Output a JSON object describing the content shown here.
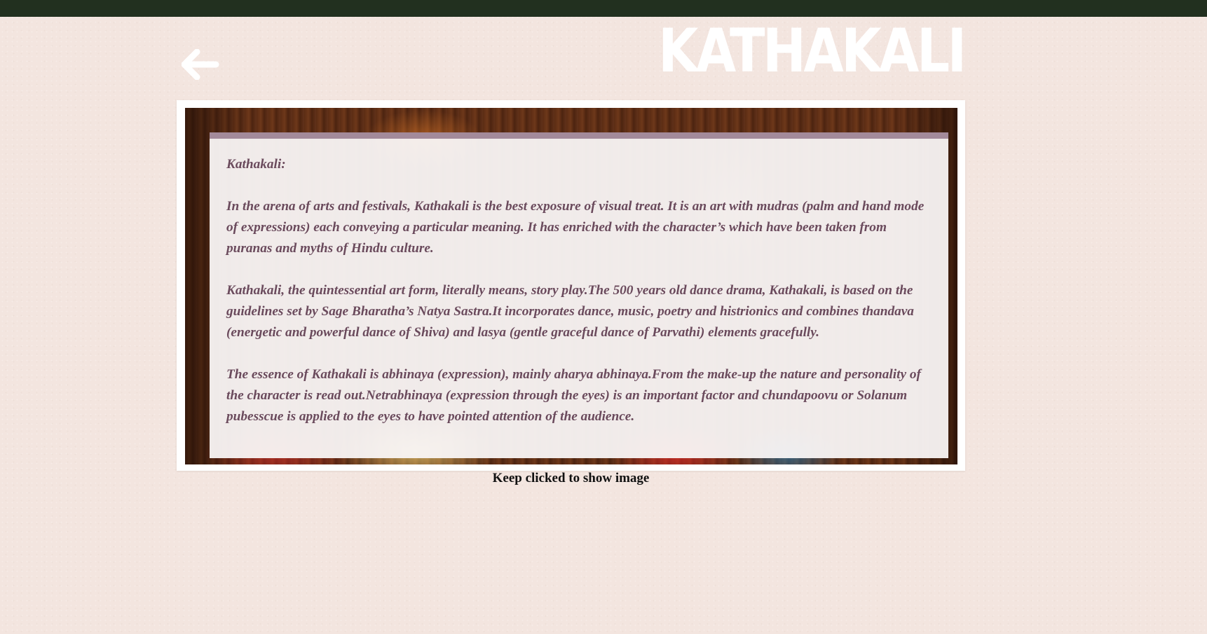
{
  "header": {
    "title": "KATHAKALI",
    "back_icon": "arrow-left-icon"
  },
  "colors": {
    "topbar": "#22301f",
    "background": "#f3e5df",
    "title": "#ffffff",
    "panel_border": "#a38a9a",
    "body_text": "#6a4a5c"
  },
  "content": {
    "heading": "Kathakali:",
    "paragraphs": [
      "In the arena of arts and festivals, Kathakali is the best exposure of visual treat. It is an art with mudras (palm and hand mode of expressions) each conveying a particular meaning. It has enriched with the character’s which have been taken from puranas and myths of Hindu culture.",
      "Kathakali, the quintessential art form, literally means, story play.The 500 years old dance drama, Kathakali, is based on the guidelines set by Sage Bharatha’s Natya Sastra.It incorporates dance, music, poetry and histrionics and combines thandava (energetic and powerful dance of Shiva) and lasya (gentle graceful dance of Parvathi) elements gracefully.",
      "The essence of Kathakali is abhinaya (expression), mainly aharya abhinaya.From the make-up the nature and personality of the character is read out.Netrabhinaya (expression through the eyes) is an important factor and chundapoovu or Solanum pubesscue is applied to the eyes to have pointed attention of the audience."
    ]
  },
  "caption": "Keep clicked to show image"
}
